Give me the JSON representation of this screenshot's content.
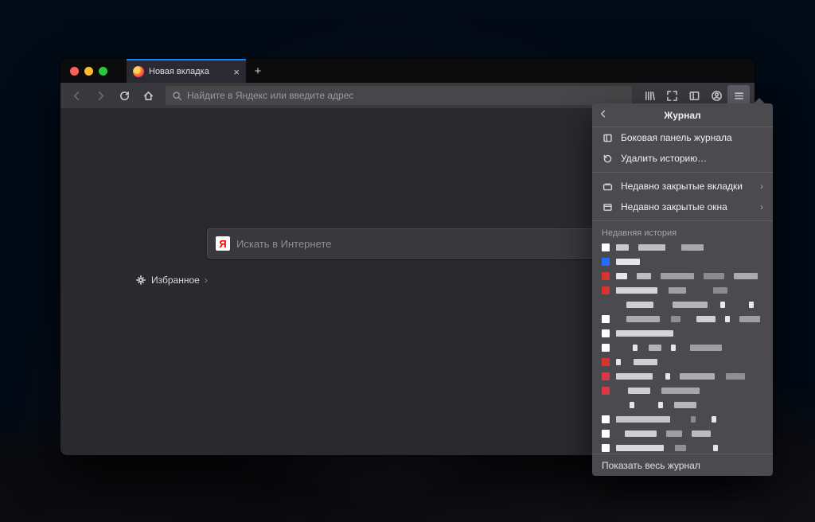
{
  "tab": {
    "title": "Новая вкладка"
  },
  "urlbar": {
    "placeholder": "Найдите в Яндекс или введите адрес"
  },
  "content": {
    "search_placeholder": "Искать в Интернете",
    "yandex_glyph": "Я",
    "favorites_label": "Избранное"
  },
  "panel": {
    "title": "Журнал",
    "items": {
      "sidebar": "Боковая панель журнала",
      "clear": "Удалить историю…",
      "recent_tabs": "Недавно закрытые вкладки",
      "recent_windows": "Недавно закрытые окна"
    },
    "section_label": "Недавняя история",
    "footer": "Показать весь журнал",
    "history": [
      {
        "fav": "#ffffff",
        "seg": [
          [
            16,
            "#c9c9cd"
          ],
          [
            6,
            "#0000"
          ],
          [
            34,
            "#bfbfc3"
          ],
          [
            14,
            "#0000"
          ],
          [
            28,
            "#a9a9ad"
          ]
        ]
      },
      {
        "fav": "#1f6fff",
        "seg": [
          [
            30,
            "#e6e6ea"
          ]
        ]
      },
      {
        "fav": "#d63333",
        "seg": [
          [
            14,
            "#e6e6ea"
          ],
          [
            6,
            "#0000"
          ],
          [
            18,
            "#bdbdc1"
          ],
          [
            6,
            "#0000"
          ],
          [
            42,
            "#9e9ea3"
          ],
          [
            6,
            "#0000"
          ],
          [
            26,
            "#8a8a8f"
          ],
          [
            6,
            "#0000"
          ],
          [
            30,
            "#ababaf"
          ]
        ]
      },
      {
        "fav": "#d63333",
        "seg": [
          [
            52,
            "#d5d5d9"
          ],
          [
            8,
            "#0000"
          ],
          [
            22,
            "#9e9ea3"
          ],
          [
            28,
            "#0000"
          ],
          [
            18,
            "#8a8a8f"
          ]
        ]
      },
      {
        "fav": "#0000",
        "seg": [
          [
            10,
            "#0000"
          ],
          [
            34,
            "#cfcfd3"
          ],
          [
            18,
            "#0000"
          ],
          [
            44,
            "#b4b4b8"
          ],
          [
            10,
            "#0000"
          ],
          [
            6,
            "#eaeaee"
          ],
          [
            24,
            "#0000"
          ],
          [
            6,
            "#eaeaee"
          ]
        ]
      },
      {
        "fav": "#ffffff",
        "seg": [
          [
            10,
            "#0000"
          ],
          [
            42,
            "#ababaf"
          ],
          [
            8,
            "#0000"
          ],
          [
            12,
            "#8e8e93"
          ],
          [
            14,
            "#0000"
          ],
          [
            24,
            "#cfcfd3"
          ],
          [
            6,
            "#0000"
          ],
          [
            6,
            "#e6e6ea"
          ],
          [
            6,
            "#0000"
          ],
          [
            26,
            "#9e9ea3"
          ]
        ]
      },
      {
        "fav": "#ffffff",
        "seg": [
          [
            72,
            "#d5d5d9"
          ]
        ]
      },
      {
        "fav": "#ffffff",
        "seg": [
          [
            18,
            "#0000"
          ],
          [
            6,
            "#e6e6ea"
          ],
          [
            8,
            "#0000"
          ],
          [
            16,
            "#b4b4b8"
          ],
          [
            6,
            "#0000"
          ],
          [
            6,
            "#e6e6ea"
          ],
          [
            12,
            "#0000"
          ],
          [
            40,
            "#9e9ea3"
          ]
        ]
      },
      {
        "fav": "#d63333",
        "seg": [
          [
            6,
            "#e6e6ea"
          ],
          [
            10,
            "#0000"
          ],
          [
            30,
            "#cfcfd3"
          ]
        ]
      },
      {
        "fav": "#d83848",
        "seg": [
          [
            46,
            "#d0d0d4"
          ],
          [
            10,
            "#0000"
          ],
          [
            6,
            "#e6e6ea"
          ],
          [
            6,
            "#0000"
          ],
          [
            44,
            "#ababaf"
          ],
          [
            8,
            "#0000"
          ],
          [
            24,
            "#8f8f94"
          ]
        ]
      },
      {
        "fav": "#d83848",
        "seg": [
          [
            12,
            "#0000"
          ],
          [
            28,
            "#cfcfd3"
          ],
          [
            8,
            "#0000"
          ],
          [
            48,
            "#a5a5aa"
          ]
        ]
      },
      {
        "fav": "#0000",
        "seg": [
          [
            14,
            "#0000"
          ],
          [
            6,
            "#e6e6ea"
          ],
          [
            24,
            "#0000"
          ],
          [
            6,
            "#e6e6ea"
          ],
          [
            8,
            "#0000"
          ],
          [
            28,
            "#b6b6ba"
          ]
        ]
      },
      {
        "fav": "#ffffff",
        "seg": [
          [
            68,
            "#c6c6ca"
          ],
          [
            20,
            "#0000"
          ],
          [
            6,
            "#8a8a8f"
          ],
          [
            14,
            "#0000"
          ],
          [
            6,
            "#e6e6ea"
          ]
        ]
      },
      {
        "fav": "#ffffff",
        "seg": [
          [
            8,
            "#0000"
          ],
          [
            40,
            "#cfcfd3"
          ],
          [
            6,
            "#0000"
          ],
          [
            20,
            "#9e9ea3"
          ],
          [
            6,
            "#0000"
          ],
          [
            24,
            "#bcbcc0"
          ]
        ]
      },
      {
        "fav": "#ffffff",
        "seg": [
          [
            60,
            "#d9d9dd"
          ],
          [
            8,
            "#0000"
          ],
          [
            14,
            "#8f8f94"
          ],
          [
            28,
            "#0000"
          ],
          [
            6,
            "#e6e6ea"
          ]
        ]
      },
      {
        "fav": "#0000",
        "seg": [
          [
            10,
            "#0000"
          ],
          [
            6,
            "#e6e6ea"
          ],
          [
            8,
            "#0000"
          ],
          [
            28,
            "#b6b6ba"
          ],
          [
            20,
            "#0000"
          ],
          [
            6,
            "#e6e6ea"
          ],
          [
            28,
            "#0000"
          ],
          [
            32,
            "#a0a0a5"
          ]
        ]
      }
    ]
  }
}
